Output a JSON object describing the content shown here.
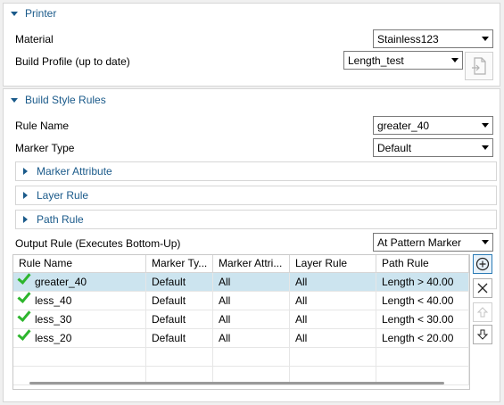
{
  "printer": {
    "title": "Printer",
    "material_label": "Material",
    "material_value": "Stainless123",
    "build_profile_label": "Build Profile (up to date)",
    "build_profile_value": "Length_test"
  },
  "build_style": {
    "title": "Build Style Rules",
    "rule_name_label": "Rule Name",
    "rule_name_value": "greater_40",
    "marker_type_label": "Marker Type",
    "marker_type_value": "Default",
    "sections": [
      "Marker Attribute",
      "Layer Rule",
      "Path Rule"
    ],
    "output_rule_label": "Output Rule (Executes Bottom-Up)",
    "output_rule_value": "At Pattern Marker"
  },
  "table": {
    "columns": [
      "Rule Name",
      "Marker Ty...",
      "Marker Attri...",
      "Layer Rule",
      "Path Rule"
    ],
    "rows": [
      {
        "name": "greater_40",
        "marker_type": "Default",
        "marker_attr": "All",
        "layer": "All",
        "path": "Length > 40.00",
        "selected": true
      },
      {
        "name": "less_40",
        "marker_type": "Default",
        "marker_attr": "All",
        "layer": "All",
        "path": "Length < 40.00",
        "selected": false
      },
      {
        "name": "less_30",
        "marker_type": "Default",
        "marker_attr": "All",
        "layer": "All",
        "path": "Length < 30.00",
        "selected": false
      },
      {
        "name": "less_20",
        "marker_type": "Default",
        "marker_attr": "All",
        "layer": "All",
        "path": "Length < 20.00",
        "selected": false
      }
    ]
  },
  "colors": {
    "accent": "#1a5a8a",
    "selection": "#cce4ef",
    "check": "#2db52d"
  },
  "icons": {
    "add": "add-circle-icon",
    "remove": "close-x-icon",
    "move_up": "arrow-up-icon",
    "move_down": "arrow-down-icon",
    "profile_import": "import-file-icon"
  }
}
